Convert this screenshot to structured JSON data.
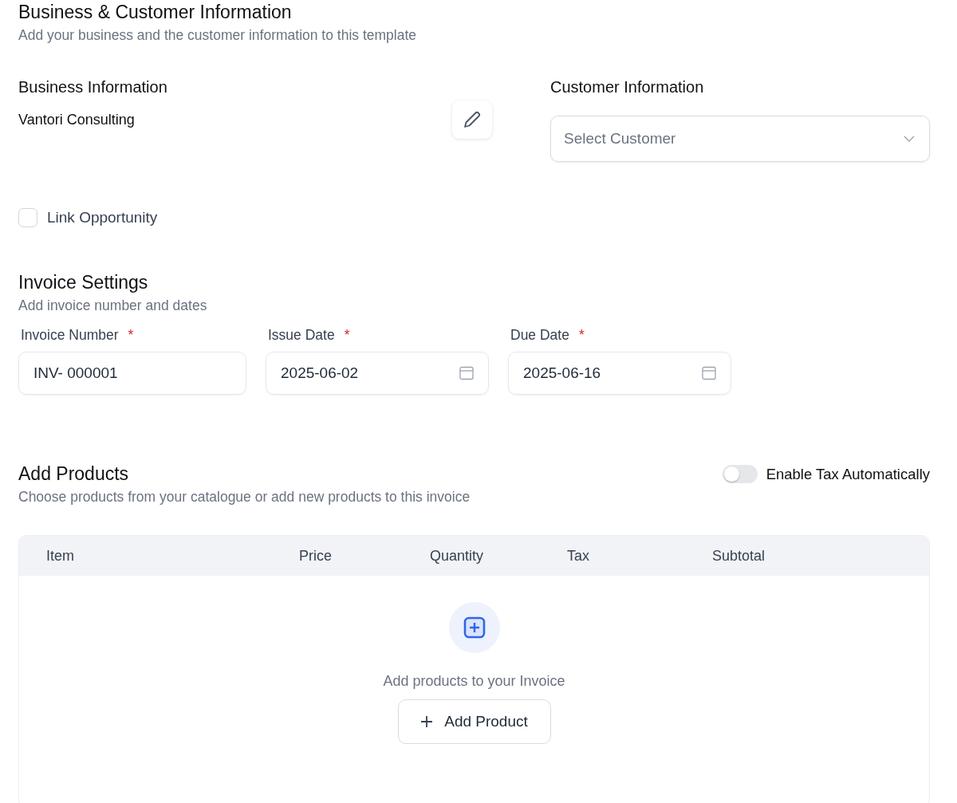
{
  "business_customer": {
    "title": "Business & Customer Information",
    "subtitle": "Add your business and the customer information to this template",
    "business": {
      "heading": "Business Information",
      "name": "Vantori Consulting"
    },
    "customer": {
      "heading": "Customer Information",
      "select": {
        "placeholder": "Select Customer"
      }
    },
    "link_opportunity": {
      "label": "Link Opportunity",
      "checked": false
    }
  },
  "invoice_settings": {
    "title": "Invoice Settings",
    "subtitle": "Add invoice number and dates",
    "fields": [
      {
        "kind": "text",
        "label": "Invoice Number",
        "required_mark": "*",
        "value": "INV- 000001"
      },
      {
        "kind": "date",
        "label": "Issue Date",
        "required_mark": "*",
        "value": "2025-06-02"
      },
      {
        "kind": "date",
        "label": "Due Date",
        "required_mark": "*",
        "value": "2025-06-16"
      }
    ]
  },
  "products": {
    "title": "Add Products",
    "subtitle": "Choose products from your catalogue or add new products to this invoice",
    "tax_toggle": {
      "label": "Enable Tax Automatically",
      "on": false
    },
    "table": {
      "columns": [
        "Item",
        "Price",
        "Quantity",
        "Tax",
        "Subtotal"
      ],
      "empty": {
        "message": "Add products to your Invoice",
        "button": "Add Product"
      }
    }
  }
}
